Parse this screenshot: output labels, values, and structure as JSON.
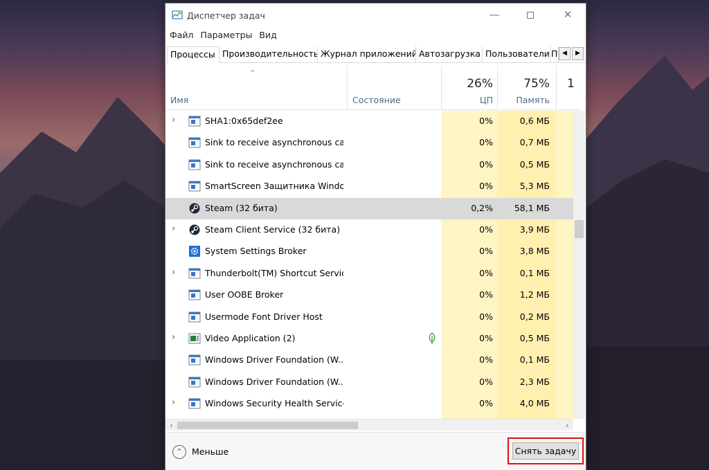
{
  "window": {
    "title": "Диспетчер задач"
  },
  "menu": [
    "Файл",
    "Параметры",
    "Вид"
  ],
  "tabs": [
    "Процессы",
    "Производительность",
    "Журнал приложений",
    "Автозагрузка",
    "Пользователи",
    "По"
  ],
  "columns": {
    "name": "Имя",
    "state": "Состояние",
    "cpu_pct": "26%",
    "cpu_label": "ЦП",
    "mem_pct": "75%",
    "mem_label": "Память",
    "next_pct": "1"
  },
  "processes": [
    {
      "name": "SHA1:0x65def2ee",
      "cpu": "0%",
      "mem": "0,6 МБ",
      "expandable": true,
      "icon": "window-icon"
    },
    {
      "name": "Sink to receive asynchronous cal...",
      "cpu": "0%",
      "mem": "0,7 МБ",
      "expandable": false,
      "icon": "window-icon"
    },
    {
      "name": "Sink to receive asynchronous cal...",
      "cpu": "0%",
      "mem": "0,5 МБ",
      "expandable": false,
      "icon": "window-icon"
    },
    {
      "name": "SmartScreen Защитника Windo...",
      "cpu": "0%",
      "mem": "5,3 МБ",
      "expandable": false,
      "icon": "window-icon"
    },
    {
      "name": "Steam (32 бита)",
      "cpu": "0,2%",
      "mem": "58,1 МБ",
      "expandable": false,
      "icon": "steam-icon",
      "selected": true
    },
    {
      "name": "Steam Client Service (32 бита)",
      "cpu": "0%",
      "mem": "3,9 МБ",
      "expandable": true,
      "icon": "steam-icon"
    },
    {
      "name": "System Settings Broker",
      "cpu": "0%",
      "mem": "3,8 МБ",
      "expandable": false,
      "icon": "gear-icon"
    },
    {
      "name": "Thunderbolt(TM) Shortcut Service",
      "cpu": "0%",
      "mem": "0,1 МБ",
      "expandable": true,
      "icon": "window-icon"
    },
    {
      "name": "User OOBE Broker",
      "cpu": "0%",
      "mem": "1,2 МБ",
      "expandable": false,
      "icon": "window-icon"
    },
    {
      "name": "Usermode Font Driver Host",
      "cpu": "0%",
      "mem": "0,2 МБ",
      "expandable": false,
      "icon": "window-icon"
    },
    {
      "name": "Video Application (2)",
      "cpu": "0%",
      "mem": "0,5 МБ",
      "expandable": true,
      "icon": "video-icon",
      "suspended_leaf": true
    },
    {
      "name": "Windows Driver Foundation (W...",
      "cpu": "0%",
      "mem": "0,1 МБ",
      "expandable": false,
      "icon": "window-icon"
    },
    {
      "name": "Windows Driver Foundation (W...",
      "cpu": "0%",
      "mem": "2,3 МБ",
      "expandable": false,
      "icon": "window-icon"
    },
    {
      "name": "Windows Security Health Service",
      "cpu": "0%",
      "mem": "4,0 МБ",
      "expandable": true,
      "icon": "window-icon"
    }
  ],
  "footer": {
    "less_label": "Меньше",
    "end_task_label": "Снять задачу"
  },
  "colors": {
    "highlight_frame": "#e01010",
    "usage_column": "#fff4c4",
    "selected_row": "#d9d9d9"
  }
}
